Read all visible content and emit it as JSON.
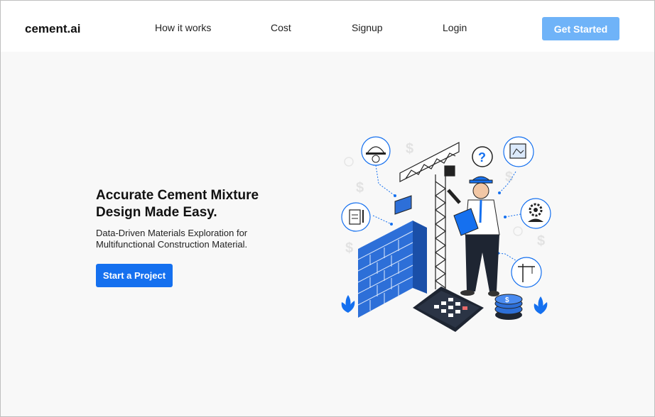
{
  "header": {
    "logo": "cement.ai",
    "nav": [
      {
        "label": "How it works"
      },
      {
        "label": "Cost"
      },
      {
        "label": "Signup"
      },
      {
        "label": "Login"
      }
    ],
    "cta": "Get Started"
  },
  "hero": {
    "title": "Accurate Cement Mixture Design Made Easy.",
    "subtitle": "Data-Driven Materials Exploration for Multifunctional Construction Material.",
    "button": "Start a Project"
  },
  "colors": {
    "primary": "#1570ef",
    "primary_light": "#6fb3f8",
    "background": "#f8f8f8",
    "header_bg": "#ffffff"
  },
  "illustration": {
    "icons": [
      "worker-helmet-icon",
      "question-mark-icon",
      "blueprint-icon",
      "clipboard-icon",
      "gear-worker-icon",
      "crane-icon",
      "dollar-icon",
      "calculator-icon",
      "coins-icon",
      "plant-icon"
    ]
  }
}
